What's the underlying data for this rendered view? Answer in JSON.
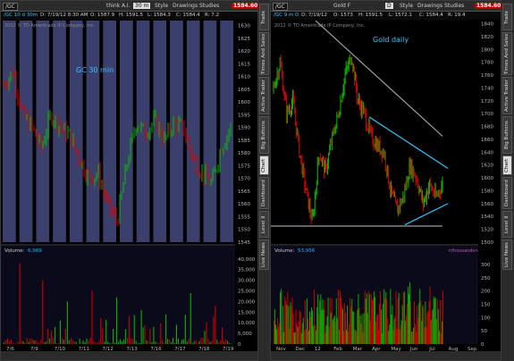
{
  "left": {
    "symbol": "/GC",
    "buttons": [
      "think A.I.",
      "30 m",
      "Style",
      "Drawings",
      "Studies"
    ],
    "last_price": "1584.60",
    "info": [
      "/GC 10 d 30m",
      "D: 7/19/12 8:30 AM",
      "O: 1587.9",
      "H: 1591.5",
      "L: 1584.3",
      "C: 1584.4",
      "R: 7.2"
    ],
    "copyright": "2012 © TD Ameritrade IP Company, Inc.",
    "chart_label": "GC 30 min",
    "price_axis": [
      "1630",
      "1625",
      "1620",
      "1615",
      "1610",
      "1605",
      "1600",
      "1595",
      "1590",
      "1585",
      "1580",
      "1575",
      "1570",
      "1565",
      "1560",
      "1555",
      "1550",
      "1545"
    ],
    "volume_label": "Volume",
    "volume_value": "6,969",
    "volume_axis": [
      "40,000",
      "35,000",
      "30,000",
      "25,000",
      "20,000",
      "15,000",
      "10,000",
      "5,000",
      "0"
    ],
    "x_axis": [
      "7/6",
      "7/9",
      "7/10",
      "7/11",
      "7/12",
      "7/13",
      "7/16",
      "7/17",
      "7/18",
      "7/19"
    ]
  },
  "right": {
    "symbol": "/GC",
    "buttons": [
      "Gold F",
      "D",
      "Style",
      "Drawings",
      "Studies"
    ],
    "last_price": "1584.60",
    "info": [
      "/GC 9 m D",
      "D: 7/19/12",
      "O: 1573",
      "H: 1591.5",
      "L: 1572.1",
      "C: 1584.4",
      "R: 19.4"
    ],
    "copyright": "2012 © TD Ameritrade IP Company, Inc.",
    "chart_label": "Gold daily",
    "price_axis": [
      "1840",
      "1820",
      "1800",
      "1780",
      "1760",
      "1740",
      "1720",
      "1700",
      "1680",
      "1660",
      "1640",
      "1620",
      "1600",
      "1580",
      "1560",
      "1540",
      "1520",
      "1500"
    ],
    "volume_label": "Volume",
    "volume_value": "53,956",
    "volume_unit": "<thousands>",
    "volume_axis": [
      "300",
      "250",
      "200",
      "150",
      "100",
      "50",
      "0"
    ],
    "x_axis": [
      "Nov",
      "Dec",
      "12",
      "Feb",
      "Mar",
      "Apr",
      "May",
      "Jun",
      "Jul",
      "Aug",
      "Sep"
    ]
  },
  "left_sidetabs": [
    "Trade",
    "Times And Sales",
    "Active Trader",
    "Big Buttons",
    "Chart",
    "Dashboard",
    "Level II",
    "Live News"
  ],
  "right_sidetabs": [
    "Trade",
    "Times And Sales",
    "Active Trader",
    "Big Buttons",
    "Chart",
    "Dashboard",
    "Level II",
    "Live News"
  ],
  "colors": {
    "up": "#00c000",
    "down": "#e00000",
    "label": "#36c3ff",
    "band": "#3b3f6b",
    "trendline": "#9aa0a6",
    "triangle": "#36c3ff"
  }
}
